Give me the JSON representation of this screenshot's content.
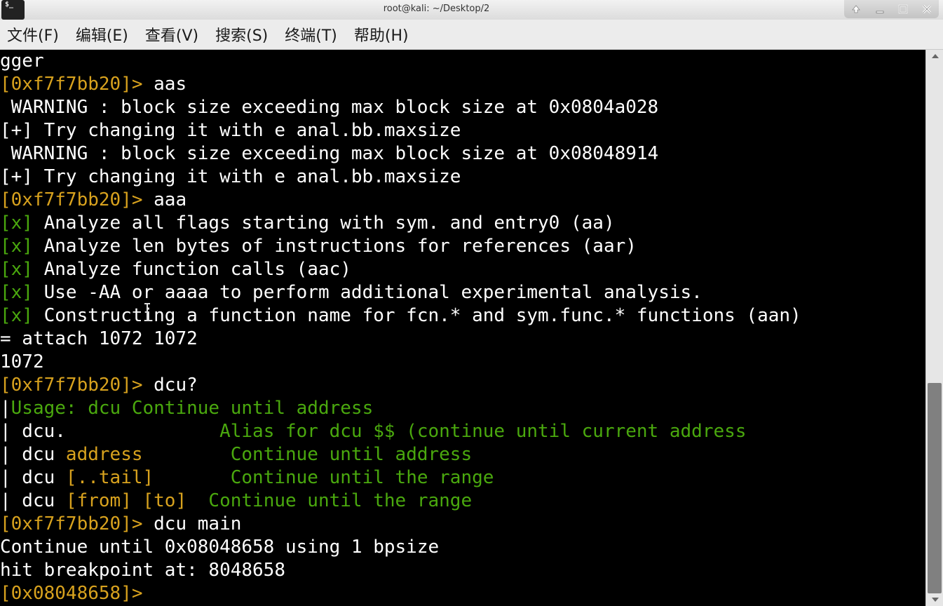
{
  "window": {
    "title": "root@kali: ~/Desktop/2",
    "app_icon_text": "$_",
    "controls": {
      "up_icon": "arrow-up-icon",
      "minimize_icon": "minimize-icon",
      "maximize_icon": "maximize-icon",
      "close_icon": "close-icon"
    }
  },
  "menubar": {
    "items": [
      {
        "label": "文件(F)"
      },
      {
        "label": "编辑(E)"
      },
      {
        "label": "查看(V)"
      },
      {
        "label": "搜索(S)"
      },
      {
        "label": "终端(T)"
      },
      {
        "label": "帮助(H)"
      }
    ]
  },
  "colors": {
    "prompt": "#d8a21e",
    "success": "#4aa80e",
    "text": "#ffffff",
    "background": "#000000"
  },
  "terminal": {
    "lines": [
      {
        "segments": [
          {
            "text": "gger",
            "color": "w"
          }
        ]
      },
      {
        "segments": [
          {
            "text": "[0xf7f7bb20]> ",
            "color": "y"
          },
          {
            "text": "aas",
            "color": "w"
          }
        ]
      },
      {
        "segments": [
          {
            "text": " WARNING : block size exceeding max block size at 0x0804a028",
            "color": "w"
          }
        ]
      },
      {
        "segments": [
          {
            "text": "[+] Try changing it with e anal.bb.maxsize",
            "color": "w"
          }
        ]
      },
      {
        "segments": [
          {
            "text": " WARNING : block size exceeding max block size at 0x08048914",
            "color": "w"
          }
        ]
      },
      {
        "segments": [
          {
            "text": "[+] Try changing it with e anal.bb.maxsize",
            "color": "w"
          }
        ]
      },
      {
        "segments": [
          {
            "text": "[0xf7f7bb20]> ",
            "color": "y"
          },
          {
            "text": "aaa",
            "color": "w"
          }
        ]
      },
      {
        "segments": [
          {
            "text": "[x]",
            "color": "g"
          },
          {
            "text": " Analyze all flags starting with sym. and entry0 (aa)",
            "color": "w"
          }
        ]
      },
      {
        "segments": [
          {
            "text": "[x]",
            "color": "g"
          },
          {
            "text": " Analyze len bytes of instructions for references (aar)",
            "color": "w"
          }
        ]
      },
      {
        "segments": [
          {
            "text": "[x]",
            "color": "g"
          },
          {
            "text": " Analyze function calls (aac)",
            "color": "w"
          }
        ]
      },
      {
        "segments": [
          {
            "text": "[x]",
            "color": "g"
          },
          {
            "text": " Use -AA or aaaa to perform additional experimental analysis.",
            "color": "w"
          }
        ]
      },
      {
        "segments": [
          {
            "text": "[x]",
            "color": "g"
          },
          {
            "text": " Constructing a function name for fcn.* and sym.func.* functions (aan)",
            "color": "w"
          }
        ]
      },
      {
        "segments": [
          {
            "text": "= attach 1072 1072",
            "color": "w"
          }
        ]
      },
      {
        "segments": [
          {
            "text": "1072",
            "color": "w"
          }
        ]
      },
      {
        "segments": [
          {
            "text": "[0xf7f7bb20]> ",
            "color": "y"
          },
          {
            "text": "dcu?",
            "color": "w"
          }
        ]
      },
      {
        "segments": [
          {
            "text": "|",
            "color": "w"
          },
          {
            "text": "Usage: dcu Continue until address",
            "color": "g"
          }
        ]
      },
      {
        "segments": [
          {
            "text": "| dcu.              ",
            "color": "w"
          },
          {
            "text": "Alias for dcu $$ (continue until current address",
            "color": "g"
          }
        ]
      },
      {
        "segments": [
          {
            "text": "| dcu ",
            "color": "w"
          },
          {
            "text": "address",
            "color": "y"
          },
          {
            "text": "        ",
            "color": "w"
          },
          {
            "text": "Continue until address",
            "color": "g"
          }
        ]
      },
      {
        "segments": [
          {
            "text": "| dcu ",
            "color": "w"
          },
          {
            "text": "[..tail]",
            "color": "y"
          },
          {
            "text": "       ",
            "color": "w"
          },
          {
            "text": "Continue until the range",
            "color": "g"
          }
        ]
      },
      {
        "segments": [
          {
            "text": "| dcu ",
            "color": "w"
          },
          {
            "text": "[from] [to]",
            "color": "y"
          },
          {
            "text": "  ",
            "color": "w"
          },
          {
            "text": "Continue until the range",
            "color": "g"
          }
        ]
      },
      {
        "segments": [
          {
            "text": "[0xf7f7bb20]> ",
            "color": "y"
          },
          {
            "text": "dcu main",
            "color": "w"
          }
        ]
      },
      {
        "segments": [
          {
            "text": "Continue until 0x08048658 using 1 bpsize",
            "color": "w"
          }
        ]
      },
      {
        "segments": [
          {
            "text": "hit breakpoint at: 8048658",
            "color": "w"
          }
        ]
      },
      {
        "segments": [
          {
            "text": "[0x08048658]> ",
            "color": "y"
          }
        ]
      }
    ]
  }
}
